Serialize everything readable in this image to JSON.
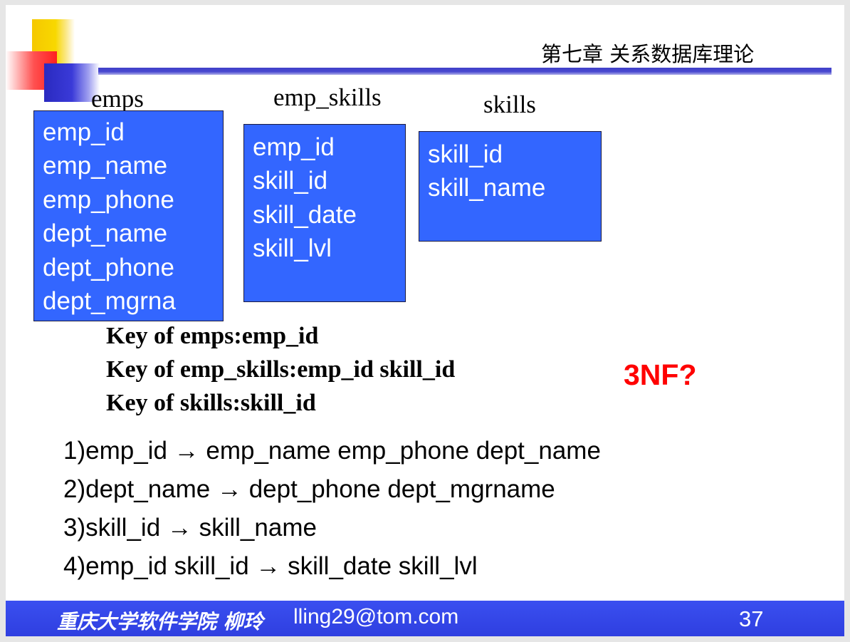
{
  "header": {
    "chapter": "第七章 关系数据库理论"
  },
  "tables": [
    {
      "name": "emps",
      "fields": [
        "emp_id",
        "emp_name",
        "emp_phone",
        "dept_name",
        "dept_phone",
        "dept_mgrna"
      ]
    },
    {
      "name": "emp_skills",
      "fields": [
        "emp_id",
        "skill_id",
        "skill_date",
        "skill_lvl"
      ]
    },
    {
      "name": "skills",
      "fields": [
        "skill_id",
        "skill_name"
      ]
    }
  ],
  "keys": [
    "Key of emps:emp_id",
    "Key of emp_skills:emp_id skill_id",
    "Key of skills:skill_id"
  ],
  "question": "3NF?",
  "dependencies": [
    "1)emp_id → emp_name emp_phone dept_name",
    "2)dept_name → dept_phone  dept_mgrname",
    "3)skill_id → skill_name",
    "4)emp_id skill_id → skill_date skill_lvl"
  ],
  "footer": {
    "institution": "重庆大学软件学院 柳玲",
    "email": "lling29@tom.com",
    "page_number": "37"
  },
  "colors": {
    "box_fill": "#3366ff",
    "question": "#ff0000",
    "footer_bar": "#3344e8",
    "header_rule": "#4040c8"
  }
}
